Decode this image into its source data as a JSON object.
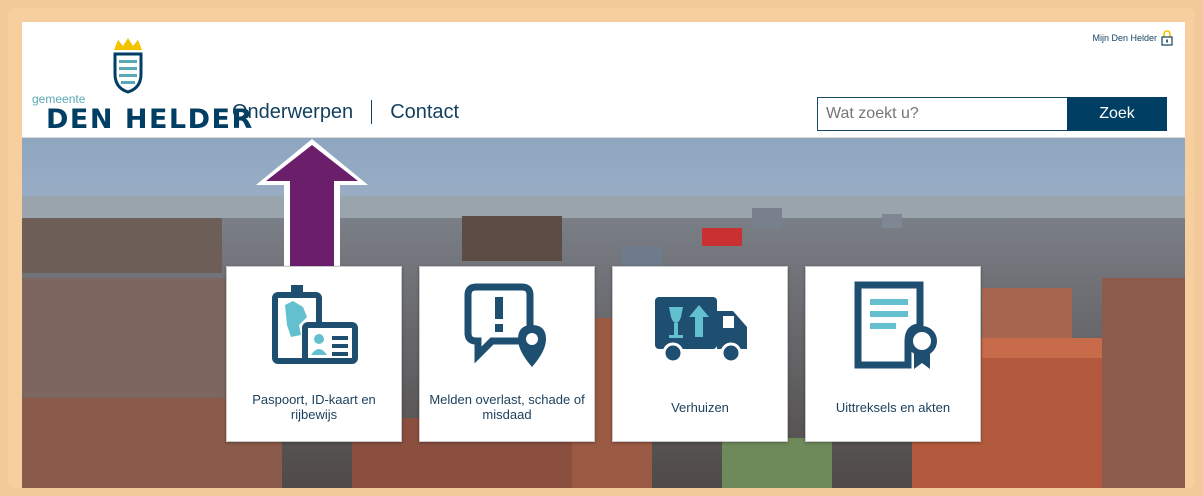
{
  "header": {
    "logo": {
      "small": "gemeente",
      "big": "DEN HELDER"
    },
    "nav": [
      {
        "label": "Onderwerpen"
      },
      {
        "label": "Contact"
      }
    ],
    "mijn_label": "Mijn Den Helder",
    "search": {
      "placeholder": "Wat zoekt u?",
      "button_label": "Zoek"
    }
  },
  "tiles": [
    {
      "label": "Paspoort, ID-kaart en rijbewijs",
      "icon": "id-card-icon"
    },
    {
      "label": "Melden overlast, schade of misdaad",
      "icon": "report-location-icon"
    },
    {
      "label": "Verhuizen",
      "icon": "moving-truck-icon"
    },
    {
      "label": "Uittreksels en akten",
      "icon": "certificate-icon"
    }
  ],
  "colors": {
    "brand": "#003e64",
    "icon": "#1f4f70",
    "accent": "#63c0cf",
    "arrow": "#6b1f6b",
    "frame": "#f7cf9f"
  }
}
